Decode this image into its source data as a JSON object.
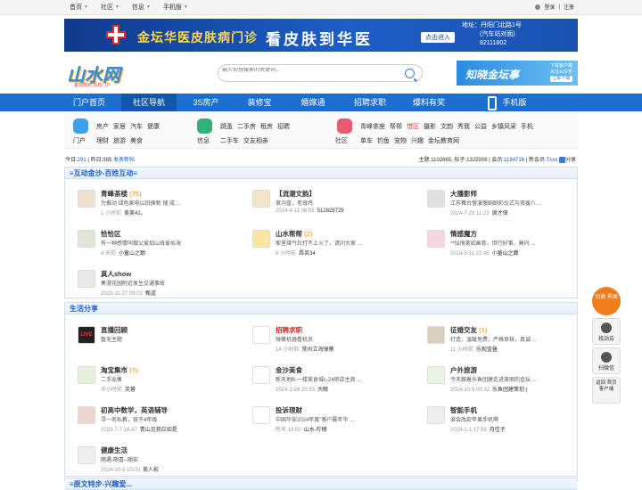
{
  "topbar": {
    "nav": [
      "首页",
      "社区",
      "信息",
      "手机版"
    ],
    "login": "登录",
    "register": "注册"
  },
  "banner": {
    "title": "金坛华医皮肤病门诊",
    "slogan": "看皮肤到华医",
    "button": "点击进入",
    "address_line1": "地址：丹阳门北路1号",
    "address_line2": "(汽车站对面)",
    "phone": "82111802"
  },
  "logo": {
    "text": "山水网",
    "sub": "金坛政府 百姓门户"
  },
  "search": {
    "placeholder": "输入你想搜索的关键词..."
  },
  "ad_right": {
    "title": "知晓金坛事",
    "sub1": "下载客户端",
    "sub2": "关注公众号",
    "sub3": "立即下载"
  },
  "mainnav": [
    "门户首页",
    "社区导航",
    "3S房产",
    "装修宝",
    "婚嫁通",
    "招聘求职",
    "爆料有奖",
    "手机版"
  ],
  "subnav": [
    {
      "name": "门户",
      "color": "#3ea0e6",
      "links": [
        "房产",
        "家居",
        "汽车",
        "健康",
        "理财",
        "旅游",
        "美食"
      ]
    },
    {
      "name": "信息",
      "color": "#2fb37a",
      "links": [
        "跳蚤",
        "二手房",
        "租房",
        "招聘",
        "二手车",
        "交友相亲"
      ]
    },
    {
      "name": "社区",
      "color": "#e95b72",
      "links": [
        "青峰茶座",
        "帮帮",
        "惜区",
        "摄影",
        "文韵",
        "秀我",
        "公益",
        "乡镇风采",
        "手机",
        "单车",
        "钓鱼",
        "宠物",
        "兴趣",
        "金坛教育网"
      ],
      "highlight": "惜区"
    }
  ],
  "stats": {
    "today_label": "今日:",
    "today": "291",
    "yesterday_label": "昨日:",
    "yesterday": "385",
    "post_new": "发表新帖",
    "topics_label": "主题:",
    "topics": "1102665",
    "posts_label": "帖子:",
    "posts": "1325506",
    "members_label": "会员:",
    "members": "1184716",
    "newest_label": "新会员:",
    "newest": "Txxx",
    "share": "分享"
  },
  "section1": {
    "title": "≡互动金沙-百姓互动≡",
    "forums": [
      {
        "name": "青峰茶楼",
        "count": "(75)",
        "desc": "为推动 绿色家电以旧换新 搜 成 ...",
        "time": "1 小时前",
        "user": "美美42。",
        "icon_bg": "#f0e4d0"
      },
      {
        "name": "【流潮文韵】",
        "count": "",
        "desc": "草沟蓝，老母鸡",
        "time": "2024-4-11 06:55",
        "user": "512828729",
        "icon_bg": "#f5e6c8"
      },
      {
        "name": "大播影师",
        "count": "",
        "desc": "江苏舞台慢演慢剧剧彩仪式与双援八 ...",
        "time": "2024-7-29 11:22",
        "user": "谢才保",
        "icon_bg": "#e0e0e0"
      },
      {
        "name": "恰恰区",
        "count": "",
        "desc": "有一种感情叫做父爱如山母爱似海",
        "time": "4 天前",
        "user": "小童山之巅",
        "icon_bg": "#dfe8d5"
      },
      {
        "name": "山水帮帮",
        "count": "(2)",
        "desc": "家里煤气灶打不上火了，请问大家 ...",
        "time": "9 小时前",
        "user": "昌英34",
        "icon_bg": "#fbe7a2"
      },
      {
        "name": "情感魔方",
        "count": "",
        "desc": "**仙境美如画卷，但行好事，莫问 ...",
        "time": "2024-5-11 23:45",
        "user": "小童山之巅",
        "icon_bg": "#f6d6e0"
      },
      {
        "name": "真人show",
        "count": "",
        "desc": "奏漫花园附近发生交通事故",
        "time": "2023-11-27 09:02",
        "user": "甄道",
        "icon_bg": "#e8e8e8"
      }
    ]
  },
  "section2": {
    "title": "生活分享",
    "forums": [
      {
        "name": "直播回顾",
        "count": "",
        "desc": "暂无主题",
        "time": "",
        "user": "",
        "icon_bg": "#222",
        "icon_text": "LIVE"
      },
      {
        "name": "招聘求职",
        "count": "",
        "desc": "弹簧机器看机员",
        "time": "14 小时前",
        "user": "常州立海弹簧",
        "icon_bg": "#fff",
        "red": true
      },
      {
        "name": "征婚交友",
        "count": "(1)",
        "desc": "打造，温暖免费，严格审核，真诚 ...",
        "time": "11 小时前",
        "user": "乐观篮叠",
        "icon_bg": "#d9d0c0"
      },
      {
        "name": "淘宝集市",
        "count": "(7)",
        "desc": "二手出售",
        "time": "半小时前",
        "user": "芙蓉",
        "icon_bg": "#e7f1d9"
      },
      {
        "name": "金沙美食",
        "count": "",
        "desc": "新天地B-一楼美食城c-24房店主商 ...",
        "time": "2024-2-24 20:55",
        "user": "大眼",
        "icon_bg": "#fff"
      },
      {
        "name": "户外旅游",
        "count": "",
        "desc": "今天跟着乐鱼团建走进美丽的金坛 ...",
        "time": "2024-10-9 09:32",
        "user": "乐鱼团建策划 (",
        "icon_bg": "#eaf3e3"
      },
      {
        "name": "初高中数学，英语辅导",
        "count": "",
        "desc": "寻一名私教，孩子4年级",
        "time": "2023-7-7 18:47",
        "user": "青山见我应如是",
        "icon_bg": "#e9d7d0"
      },
      {
        "name": "投诉理财",
        "count": "",
        "desc": "中国华安2024年度\"客户晨年华 ...",
        "time": "昨天 10:50",
        "user": "山水-柠檬",
        "icon_bg": "#fff"
      },
      {
        "name": "智能手机",
        "count": "",
        "desc": "谁会改款苹果手机啊",
        "time": "2024-1-1 17:59",
        "user": "月佳子",
        "icon_bg": "#eee"
      },
      {
        "name": "健康生活",
        "count": "",
        "desc": "随遇-随喜--随安",
        "time": "2024-10-5 10:03",
        "user": "美人影",
        "icon_bg": "#eee"
      }
    ]
  },
  "section3": {
    "title": "≡原文特步-兴趣爱..."
  },
  "sidetools": {
    "switch": "切换 界面",
    "tools": [
      "找站告",
      "扫微信",
      "返回 首页 客户端"
    ]
  }
}
